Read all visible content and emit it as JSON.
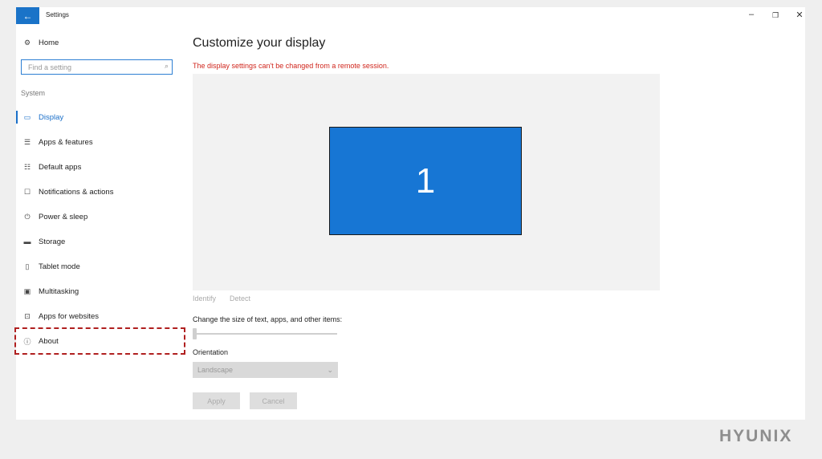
{
  "window": {
    "title": "Settings",
    "controls": {
      "back": "←",
      "minimize": "–",
      "maximize": "❐",
      "close": "✕"
    }
  },
  "sidebar": {
    "home": {
      "icon": "gear-icon",
      "glyph": "⚙",
      "label": "Home"
    },
    "search": {
      "placeholder": "Find a setting",
      "icon_glyph": "⌕"
    },
    "section": "System",
    "items": [
      {
        "icon": "monitor-icon",
        "glyph": "▭",
        "label": "Display",
        "active": true
      },
      {
        "icon": "list-icon",
        "glyph": "☰",
        "label": "Apps & features"
      },
      {
        "icon": "default-apps-icon",
        "glyph": "☷",
        "label": "Default apps"
      },
      {
        "icon": "notification-icon",
        "glyph": "☐",
        "label": "Notifications & actions"
      },
      {
        "icon": "power-icon",
        "glyph": "⏻",
        "label": "Power & sleep"
      },
      {
        "icon": "storage-icon",
        "glyph": "▬",
        "label": "Storage"
      },
      {
        "icon": "tablet-icon",
        "glyph": "▯",
        "label": "Tablet mode"
      },
      {
        "icon": "multitasking-icon",
        "glyph": "▣",
        "label": "Multitasking"
      },
      {
        "icon": "apps-websites-icon",
        "glyph": "⊡",
        "label": "Apps for websites"
      },
      {
        "icon": "info-icon",
        "glyph": "ⓘ",
        "label": "About",
        "highlighted": true
      }
    ]
  },
  "main": {
    "title": "Customize your display",
    "warning": "The display settings can't be changed from a remote session.",
    "monitor_number": "1",
    "identify": "Identify",
    "detect": "Detect",
    "scale_label": "Change the size of text, apps, and other items:",
    "scale_level": 0,
    "orientation_label": "Orientation",
    "orientation_value": "Landscape",
    "chevron_glyph": "⌄",
    "apply": "Apply",
    "cancel": "Cancel"
  },
  "colors": {
    "accent": "#1a73c8",
    "monitor": "#1776d4",
    "warning": "#d0261d",
    "highlight": "#b02020"
  },
  "brand": "HYUNIX"
}
